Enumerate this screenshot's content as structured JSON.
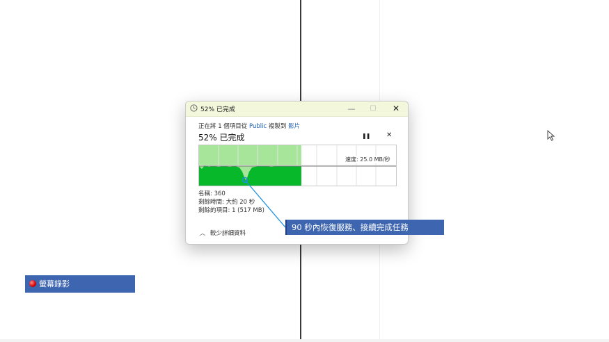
{
  "dialog": {
    "title": "52% 已完成",
    "copy_prefix": "正在將 1 個項目從",
    "source": "Public",
    "copy_middle": "複製到",
    "destination": "影片",
    "percent_text": "52% 已完成",
    "speed": "速度: 25.0 MB/秒",
    "progress": 0.52,
    "name_line": "名稱: 360",
    "time_line": "剩餘時間: 大約 20 秒",
    "items_line": "剩餘的項目: 1 (517 MB)",
    "less_details": "較少詳細資料"
  },
  "callout": {
    "text": "90 秒內恢復服務、接續完成任務"
  },
  "recording": {
    "label": "螢幕錄影"
  },
  "icons": {
    "title": "clock-icon",
    "minimize": "minimize-icon",
    "maximize": "maximize-icon",
    "close": "close-icon",
    "pause": "pause-icon",
    "cancel": "cancel-icon",
    "expand": "chevron-up-icon",
    "cursor": "mouse-cursor-icon"
  },
  "colors": {
    "graph_fill": "#06b82a",
    "graph_done_area": "#a6e59a",
    "callout_bg": "#3e66b0",
    "title_bar": "#f3f8dc"
  }
}
